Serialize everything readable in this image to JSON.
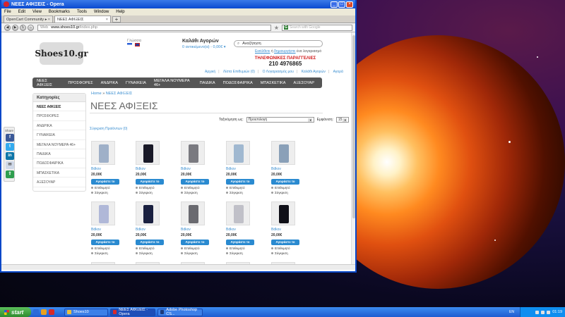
{
  "window": {
    "title": "ΝΕΕΣ ΑΦΙΞΕΙΣ - Opera",
    "menu": [
      "File",
      "Edit",
      "View",
      "Bookmarks",
      "Tools",
      "Window",
      "Help"
    ],
    "tabs": [
      {
        "label": "OpenCart Community ▸"
      },
      {
        "label": "ΝΕΕΣ ΑΦΙΞΕΙΣ"
      }
    ],
    "address": {
      "prefix": "Web",
      "host": "www.shoes10.gr",
      "path": "/index.php"
    },
    "search_placeholder": "Search with Google"
  },
  "header": {
    "logo": "Shoes10.gr",
    "lang_label": "Γλώσσα",
    "cart_title": "Καλάθι Αγορών",
    "cart_summary": "0 αντικείμενο(α) - 0,00€ ▾",
    "search_value": "Αναζήτηση",
    "welcome_login": "Εισέλθετε",
    "welcome_mid": " ή ",
    "welcome_register": "δημιουργήστε",
    "welcome_rest": " ένα λογαριασμό",
    "phone_label": "ΤΗΛΕΦΩΝΙΚΕΣ ΠΑΡΑΓΓΕΛΙΕΣ",
    "phone_number": "210 4976865",
    "links": [
      "Αρχική",
      "Λίστα Επιθυμιών (0)",
      "Ο Λογαριασμός μου",
      "Καλάθι Αγορών",
      "Αγορά"
    ]
  },
  "menu": [
    "ΝΕΕΣ ΑΦΙΞΕΙΣ",
    "ΠΡΟΣΦΟΡΕΣ",
    "ΑΝΔΡΙΚΑ",
    "ΓΥΝΑΙΚΕΙΑ",
    "ΜΕΓΑΛΑ ΝΟΥΜΕΡΑ 46+",
    "ΠΑΙΔΙΚΑ",
    "ΠΟΔΟΣΦΑΙΡΙΚΑ",
    "ΜΠΑΣΚΕΤΙΚΑ",
    "ΑΞΕΣΟΥΑΡ"
  ],
  "sidebar": {
    "heading": "Κατηγορίες",
    "items": [
      "ΝΕΕΣ ΑΦΙΞΕΙΣ",
      "ΠΡΟΣΦΟΡΕΣ",
      "ΑΝΔΡΙΚΑ",
      "ΓΥΝΑΙΚΕΙΑ",
      "ΜΕΓΑΛΑ ΝΟΥΜΕΡΑ 46+",
      "ΠΑΙΔΙΚΑ",
      "ΠΟΔΟΣΦΑΙΡΙΚΑ",
      "ΜΠΑΣΚΕΤΙΚΑ",
      "ΑΞΕΣΟΥΑΡ"
    ]
  },
  "content": {
    "breadcrumb_home": "Home",
    "breadcrumb_sep": " » ",
    "breadcrumb_current": "ΝΕΕΣ ΑΦΙΞΕΙΣ",
    "title": "ΝΕΕΣ ΑΦΙΞΕΙΣ",
    "sort_label": "Ταξινόμηση ως:",
    "sort_value": "Προεπιλογή",
    "show_label": "Εμφάνιση:",
    "show_value": "15",
    "compare_text": "Σύγκριση Προϊόντων (0)",
    "product_name": "Bdkov",
    "product_price": "20,00€",
    "buy_label": "Αγοράστε το",
    "wishlist_label": "Επιθυμητό",
    "compare_label": "Σύγκριση"
  },
  "share": {
    "label": "Share"
  },
  "taskbar": {
    "start": "start",
    "tasks": [
      "Shoes10",
      "ΝΕΕΣ ΑΦΙΞΕΙΣ - Opera",
      "Adobe Photoshop CS..."
    ],
    "lang": "EN",
    "time": "01:19"
  },
  "colors": {
    "accent": "#2a8ad0",
    "menu_bg": "#555555",
    "phone_red": "#d01818"
  }
}
